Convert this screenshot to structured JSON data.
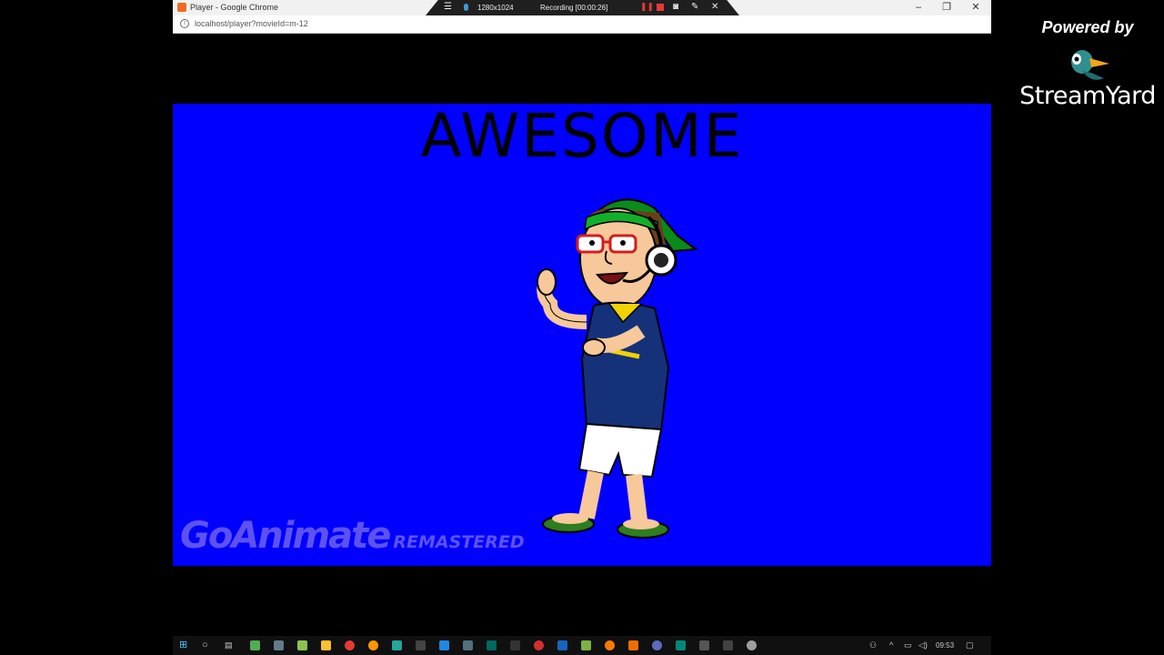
{
  "window": {
    "title": "Player - Google Chrome",
    "minimize": "–",
    "restore": "❐",
    "close": "✕"
  },
  "recorder": {
    "resolution": "1280x1024",
    "status": "Recording [00:00:26]"
  },
  "addressbar": {
    "url": "localhost/player?movieId=m-12"
  },
  "player": {
    "scene_text": "AWESOME",
    "background_color": "#0000ff",
    "watermark_brand": "GoAnimate",
    "watermark_sub": "REMASTERED"
  },
  "taskbar": {
    "clock": "09:53"
  },
  "streamyard": {
    "powered_by": "Powered by",
    "name": "StreamYard"
  }
}
